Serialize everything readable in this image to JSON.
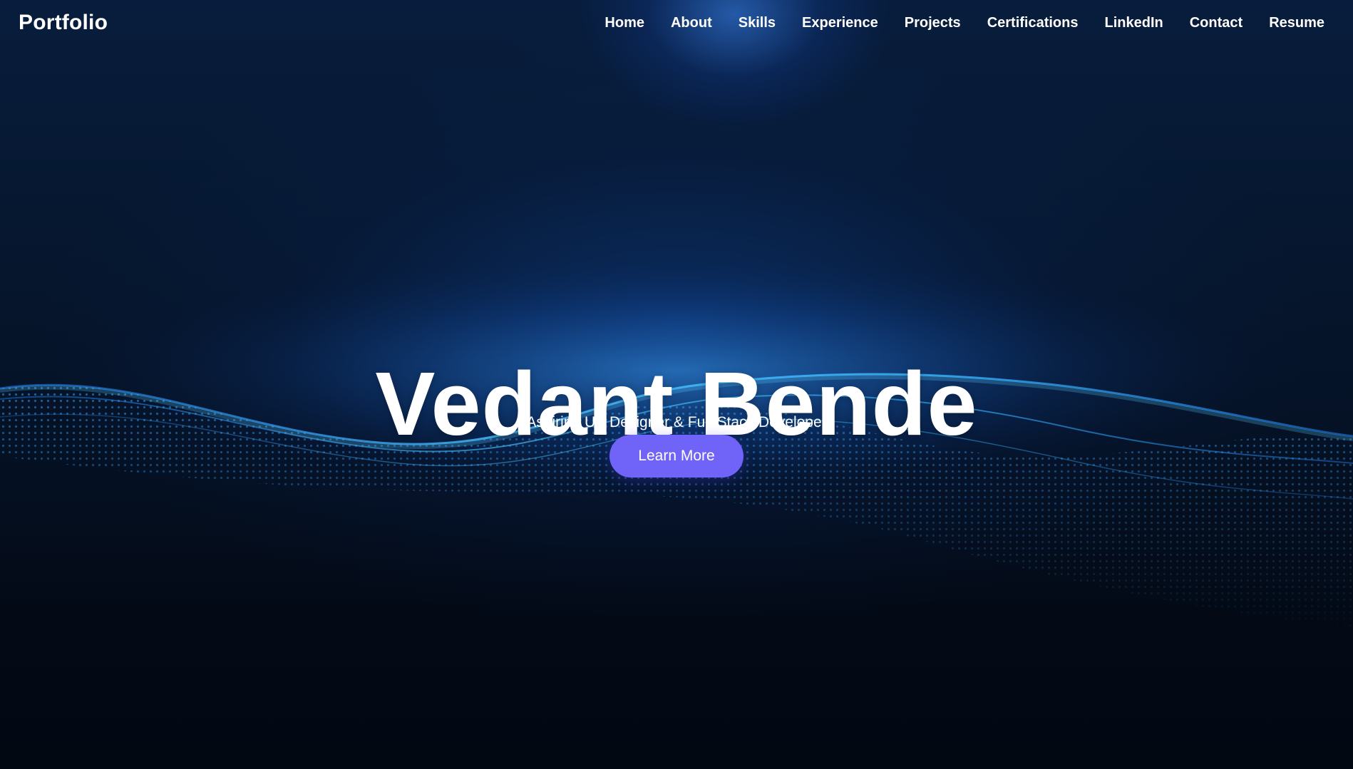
{
  "header": {
    "brand": "Portfolio"
  },
  "nav": {
    "items": [
      {
        "label": "Home",
        "name": "nav-home"
      },
      {
        "label": "About",
        "name": "nav-about"
      },
      {
        "label": "Skills",
        "name": "nav-skills"
      },
      {
        "label": "Experience",
        "name": "nav-experience"
      },
      {
        "label": "Projects",
        "name": "nav-projects"
      },
      {
        "label": "Certifications",
        "name": "nav-certifications"
      },
      {
        "label": "LinkedIn",
        "name": "nav-linkedin"
      },
      {
        "label": "Contact",
        "name": "nav-contact"
      },
      {
        "label": "Resume",
        "name": "nav-resume"
      }
    ]
  },
  "hero": {
    "title": "Vedant Bende",
    "subtitle": "Aspiring UX Designer & Full-Stack Developer",
    "cta_label": "Learn More"
  },
  "colors": {
    "accent": "#6f64f7",
    "background": "#051226",
    "wave": "#2fa8ff"
  }
}
